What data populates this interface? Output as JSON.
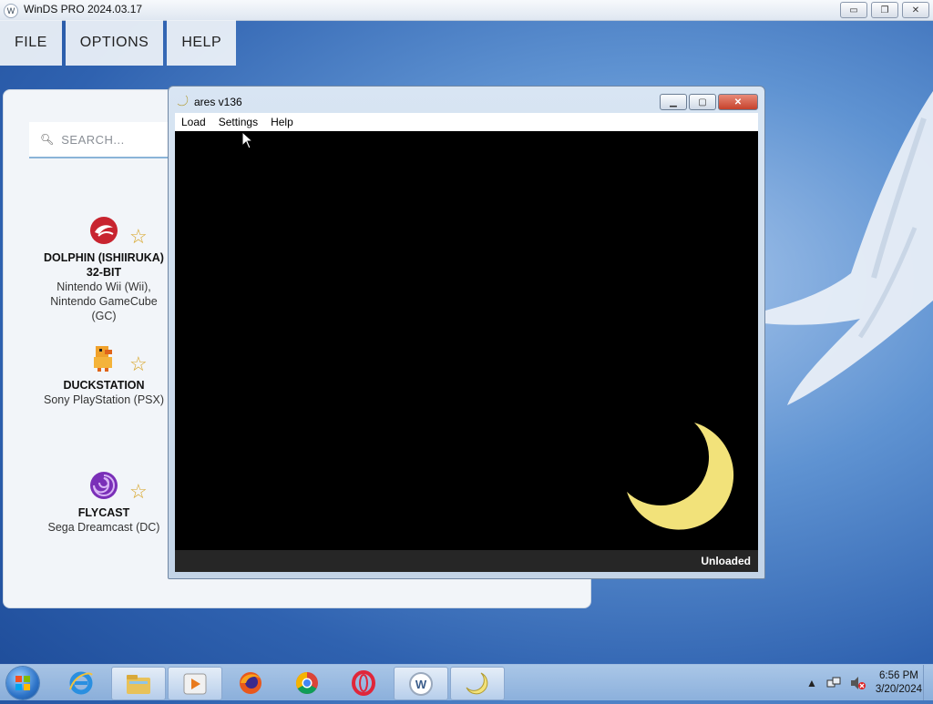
{
  "winds": {
    "title": "WinDS PRO 2024.03.17",
    "icon_letter": "W",
    "menu": [
      "FILE",
      "OPTIONS",
      "HELP"
    ],
    "controls": {
      "minimize": "▭",
      "restore": "❐",
      "close": "✕"
    }
  },
  "panel": {
    "search_placeholder": "SEARCH...",
    "emulators": [
      {
        "name": "DOLPHIN (ISHIIRUKA) 32-BIT",
        "systems": "Nintendo Wii (Wii), Nintendo GameCube (GC)",
        "icon": "dolphin-icon",
        "favorite": false
      },
      {
        "name": "DUCKSTATION",
        "systems": "Sony PlayStation (PSX)",
        "icon": "duckstation-icon",
        "favorite": false
      },
      {
        "name": "FLYCAST",
        "systems": "Sega Dreamcast (DC)",
        "icon": "flycast-icon",
        "favorite": false
      }
    ],
    "star_glyph": "☆"
  },
  "ares": {
    "title": "ares v136",
    "menu": [
      "Load",
      "Settings",
      "Help"
    ],
    "status": "Unloaded",
    "controls": {
      "minimize": "▁",
      "maximize": "▢",
      "close": "✕"
    },
    "moon_color": "#f2e27a"
  },
  "taskbar": {
    "apps": [
      "internet-explorer-icon",
      "file-explorer-icon",
      "media-player-icon",
      "firefox-icon",
      "chrome-icon",
      "opera-icon",
      "winds-icon",
      "ares-icon"
    ],
    "time": "6:56 PM",
    "date": "3/20/2024",
    "tray": {
      "arrow": "▲"
    }
  }
}
